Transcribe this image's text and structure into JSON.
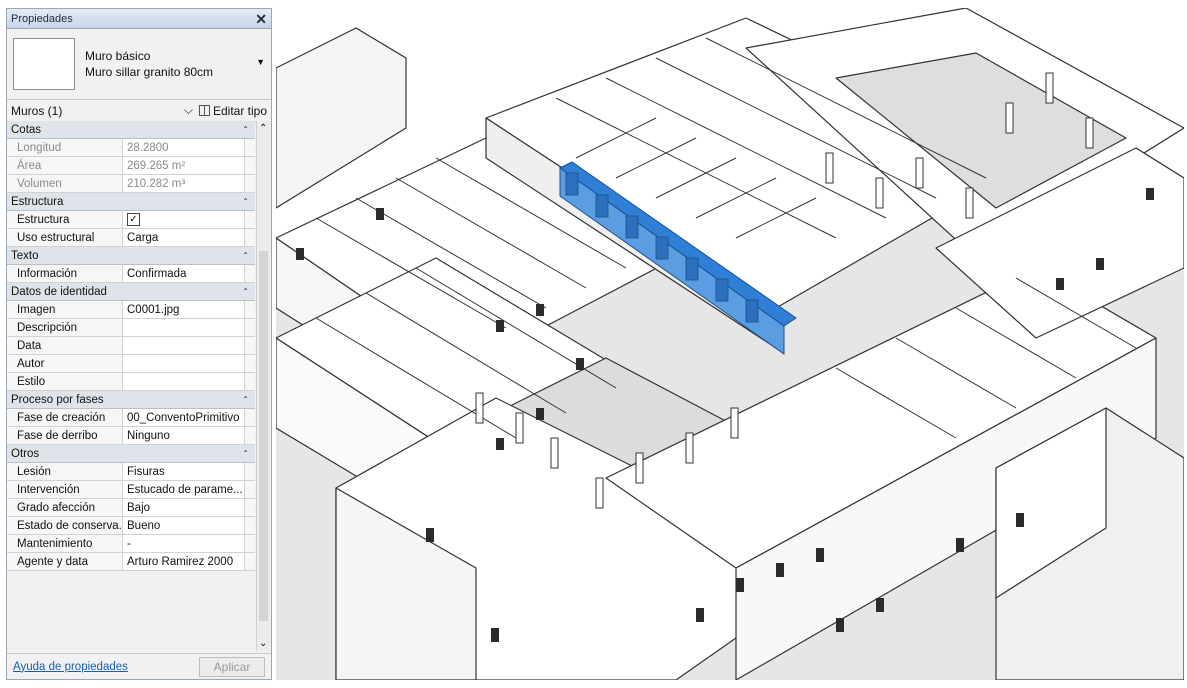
{
  "panel": {
    "title": "Propiedades",
    "close_icon": "close-icon",
    "type_family": "Muro básico",
    "type_name": "Muro sillar granito 80cm",
    "filter_label": "Muros (1)",
    "edit_type_label": "Editar tipo",
    "help_link": "Ayuda de propiedades",
    "apply_label": "Aplicar"
  },
  "sections": {
    "cotas": {
      "label": "Cotas",
      "longitud_label": "Longitud",
      "longitud_value": "28.2800",
      "area_label": "Área",
      "area_value": "269.265 m²",
      "volumen_label": "Volumen",
      "volumen_value": "210.282 m³"
    },
    "estructura": {
      "label": "Estructura",
      "estructura_label": "Estructura",
      "estructura_checked": true,
      "uso_label": "Uso estructural",
      "uso_value": "Carga"
    },
    "texto": {
      "label": "Texto",
      "info_label": "Información",
      "info_value": "Confirmada"
    },
    "identidad": {
      "label": "Datos de identidad",
      "imagen_label": "Imagen",
      "imagen_value": "C0001.jpg",
      "descripcion_label": "Descripción",
      "descripcion_value": "",
      "data_label": "Data",
      "data_value": "",
      "autor_label": "Autor",
      "autor_value": "",
      "estilo_label": "Estilo",
      "estilo_value": ""
    },
    "fases": {
      "label": "Proceso por fases",
      "creacion_label": "Fase de creación",
      "creacion_value": "00_ConventoPrimitivo",
      "derribo_label": "Fase de derribo",
      "derribo_value": "Ninguno"
    },
    "otros": {
      "label": "Otros",
      "lesion_label": "Lesión",
      "lesion_value": "Fisuras",
      "intervencion_label": "Intervención",
      "intervencion_value": "Estucado de parame...",
      "grado_label": "Grado afección",
      "grado_value": "Bajo",
      "estado_label": "Estado de conserva...",
      "estado_value": "Bueno",
      "mantenimiento_label": "Mantenimiento",
      "mantenimiento_value": "-",
      "agente_label": "Agente y data",
      "agente_value": "Arturo Ramirez 2000"
    }
  },
  "viewport": {
    "highlight_color": "#2f7fd6",
    "wall_color": "#ffffff",
    "shade_color": "#d7d7d7",
    "line_color": "#333333"
  }
}
